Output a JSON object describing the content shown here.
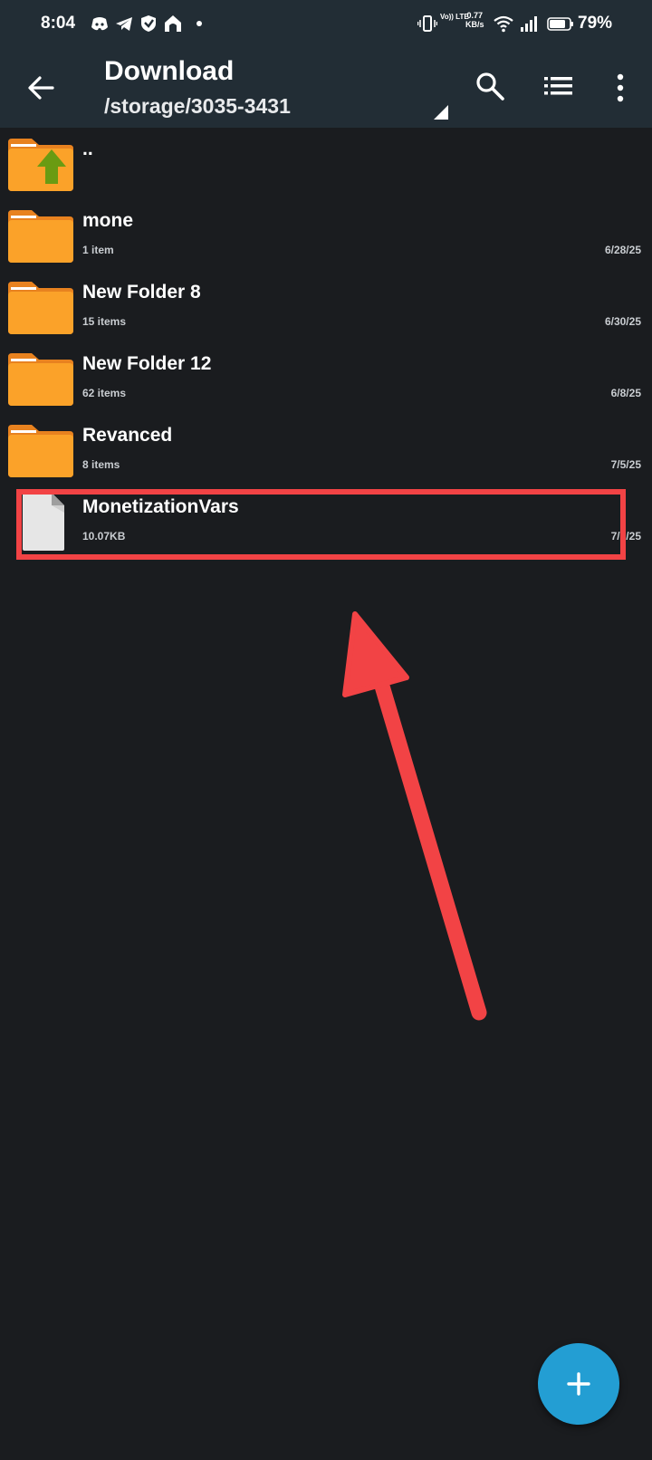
{
  "status_bar": {
    "time": "8:04",
    "net_speed_value": "0.77",
    "net_speed_unit": "KB/s",
    "volte": "Vo)) LTE",
    "battery_percent": "79%",
    "notification_icons": [
      "discord-icon",
      "telegram-icon",
      "shield-icon",
      "home-icon",
      "dot-icon"
    ],
    "system_icons": [
      "vibrate-icon",
      "volte-icon",
      "wifi-icon",
      "signal-icon",
      "battery-icon"
    ]
  },
  "appbar": {
    "title": "Download",
    "path": "/storage/3035-3431",
    "actions": [
      "back-icon",
      "search-icon",
      "list-view-icon",
      "more-icon"
    ]
  },
  "files": [
    {
      "name": "..",
      "meta": "",
      "date": "",
      "type": "parent-folder"
    },
    {
      "name": "mone",
      "meta": "1 item",
      "date": "6/28/25",
      "type": "folder"
    },
    {
      "name": "New Folder 8",
      "meta": "15 items",
      "date": "6/30/25",
      "type": "folder"
    },
    {
      "name": "New Folder 12",
      "meta": "62 items",
      "date": "6/8/25",
      "type": "folder"
    },
    {
      "name": "Revanced",
      "meta": "8 items",
      "date": "7/5/25",
      "type": "folder"
    },
    {
      "name": "MonetizationVars",
      "meta": "10.07KB",
      "date": "7/5/25",
      "type": "file"
    }
  ],
  "fab": {
    "icon": "plus-icon"
  },
  "colors": {
    "background": "#1a1c1f",
    "appbar": "#222d35",
    "folder": "#fba229",
    "folder_tab": "#e8821f",
    "parent_arrow": "#6a9b12",
    "highlight": "#f24345",
    "fab": "#239ed3"
  }
}
